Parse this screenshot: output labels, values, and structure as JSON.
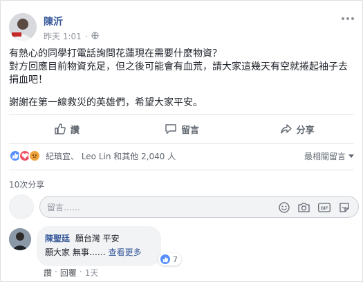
{
  "post": {
    "author": "陳沂",
    "time": "昨天 1:01",
    "privacy_icon": "public-globe-icon",
    "lines": [
      "有熱心的同學打電話詢問花蓮現在需要什麼物資？",
      "對方回應目前物資充足，但之後可能會有血荒，請大家這幾天有空就捲起袖子去捐血吧！",
      "謝謝在第一線救災的英雄們，希望大家平安。"
    ]
  },
  "actions": {
    "like": "讚",
    "comment": "留言",
    "share": "分享"
  },
  "reactions": {
    "icons": [
      "like",
      "love",
      "angry"
    ],
    "summary": "紀瑱宜、 Leo Lin 和其他 2,040 人",
    "sort_label": "最相關留言"
  },
  "shares": "10次分享",
  "comment_box": {
    "placeholder": "留言……",
    "icons": [
      "emoji-icon",
      "camera-icon",
      "gif-icon",
      "sticker-icon"
    ]
  },
  "comment": {
    "author": "陳聖廷",
    "text_line1": "願台灣 平安",
    "text_line2": "願大家 無事……",
    "see_more": "查看更多",
    "likes": "7",
    "like_label": "讚",
    "reply_label": "回覆",
    "time": "1天"
  },
  "colors": {
    "link": "#365899",
    "muted": "#90949c",
    "action": "#606770",
    "like_blue": "#5890ff",
    "love_red": "#f25268",
    "angry_orange": "#f0a33c"
  }
}
